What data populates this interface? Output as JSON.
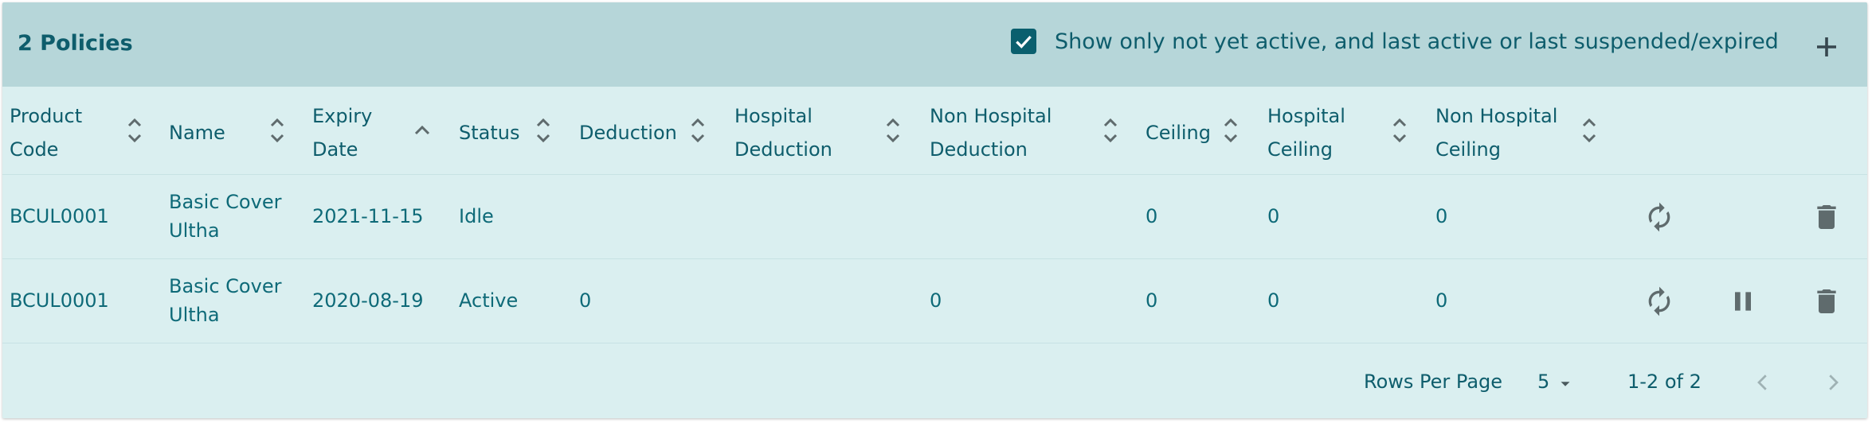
{
  "header": {
    "title": "2 Policies",
    "filter_label": "Show only not yet active, and last active or last suspended/expired",
    "filter_checked": true
  },
  "columns": [
    {
      "line1": "Product",
      "line2": "Code"
    },
    {
      "line1": "Name",
      "line2": ""
    },
    {
      "line1": "Expiry",
      "line2": "Date"
    },
    {
      "line1": "Status",
      "line2": ""
    },
    {
      "line1": "Deduction",
      "line2": ""
    },
    {
      "line1": "Hospital",
      "line2": "Deduction"
    },
    {
      "line1": "Non Hospital",
      "line2": "Deduction"
    },
    {
      "line1": "Ceiling",
      "line2": ""
    },
    {
      "line1": "Hospital",
      "line2": "Ceiling"
    },
    {
      "line1": "Non Hospital",
      "line2": "Ceiling"
    }
  ],
  "rows": [
    {
      "product_code": "BCUL0001",
      "name_line1": "Basic Cover",
      "name_line2": "Ultha",
      "expiry_date": "2021-11-15",
      "status": "Idle",
      "deduction": "",
      "hospital_deduction": "",
      "non_hospital_deduction": "",
      "ceiling": "0",
      "hospital_ceiling": "0",
      "non_hospital_ceiling": "0",
      "actions": [
        "refresh-icon",
        "delete-icon"
      ]
    },
    {
      "product_code": "BCUL0001",
      "name_line1": "Basic Cover",
      "name_line2": "Ultha",
      "expiry_date": "2020-08-19",
      "status": "Active",
      "deduction": "0",
      "hospital_deduction": "",
      "non_hospital_deduction": "0",
      "ceiling": "0",
      "hospital_ceiling": "0",
      "non_hospital_ceiling": "0",
      "actions": [
        "refresh-icon",
        "pause-icon",
        "delete-icon"
      ]
    }
  ],
  "footer": {
    "rows_per_page_label": "Rows Per Page",
    "rows_per_page_value": "5",
    "range": "1-2 of 2"
  },
  "colors": {
    "header_bg": "#b6d6d9",
    "panel_bg": "#daeff0",
    "accent": "#0a5f6e",
    "icon_gray": "#5f6b6d"
  }
}
